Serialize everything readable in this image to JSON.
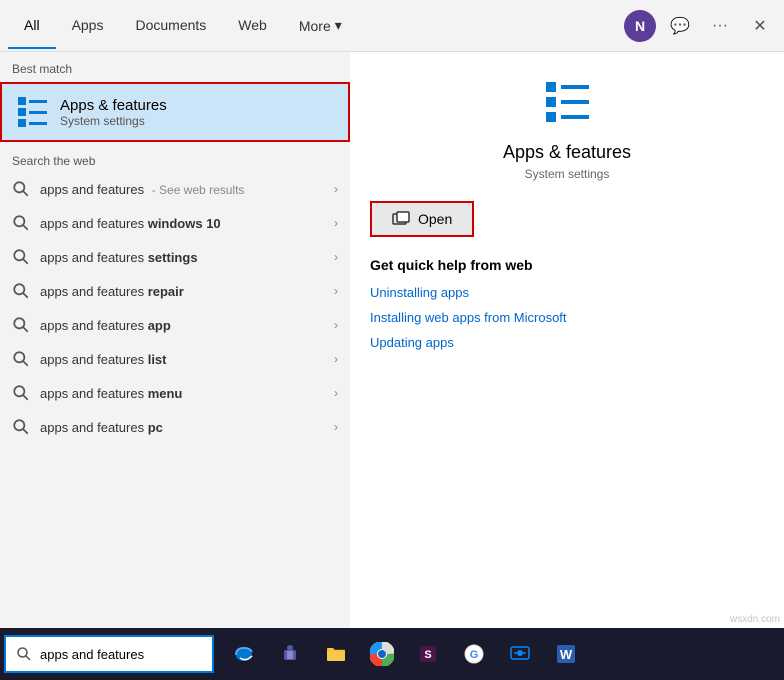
{
  "nav": {
    "tabs": [
      {
        "label": "All",
        "active": true
      },
      {
        "label": "Apps",
        "active": false
      },
      {
        "label": "Documents",
        "active": false
      },
      {
        "label": "Web",
        "active": false
      },
      {
        "label": "More",
        "active": false
      }
    ],
    "avatar_letter": "N",
    "more_dropdown": "▾"
  },
  "left_panel": {
    "best_match_label": "Best match",
    "best_match": {
      "title": "Apps & features",
      "subtitle": "System settings"
    },
    "search_web_label": "Search the web",
    "search_items": [
      {
        "text_plain": "apps and features",
        "text_bold": "",
        "suffix": "- See web results"
      },
      {
        "text_plain": "apps and features ",
        "text_bold": "windows 10",
        "suffix": ""
      },
      {
        "text_plain": "apps and features ",
        "text_bold": "settings",
        "suffix": ""
      },
      {
        "text_plain": "apps and features ",
        "text_bold": "repair",
        "suffix": ""
      },
      {
        "text_plain": "apps and features ",
        "text_bold": "app",
        "suffix": ""
      },
      {
        "text_plain": "apps and features ",
        "text_bold": "list",
        "suffix": ""
      },
      {
        "text_plain": "apps and features ",
        "text_bold": "menu",
        "suffix": ""
      },
      {
        "text_plain": "apps and features ",
        "text_bold": "pc",
        "suffix": ""
      }
    ]
  },
  "right_panel": {
    "app_title": "Apps & features",
    "app_subtitle": "System settings",
    "open_button": "Open",
    "quick_help_title": "Get quick help from web",
    "quick_help_links": [
      "Uninstalling apps",
      "Installing web apps from Microsoft",
      "Updating apps"
    ]
  },
  "taskbar": {
    "search_placeholder": "apps and features",
    "search_value": "apps and features",
    "icons": [
      {
        "name": "edge",
        "symbol": "🌐"
      },
      {
        "name": "teams",
        "symbol": "👥"
      },
      {
        "name": "folder",
        "symbol": "📁"
      },
      {
        "name": "chrome",
        "symbol": "⊙"
      },
      {
        "name": "slack",
        "symbol": "✦"
      },
      {
        "name": "google",
        "symbol": "G"
      },
      {
        "name": "remote",
        "symbol": "🖥"
      },
      {
        "name": "word",
        "symbol": "W"
      }
    ]
  },
  "watermark": "wsxdn.com"
}
